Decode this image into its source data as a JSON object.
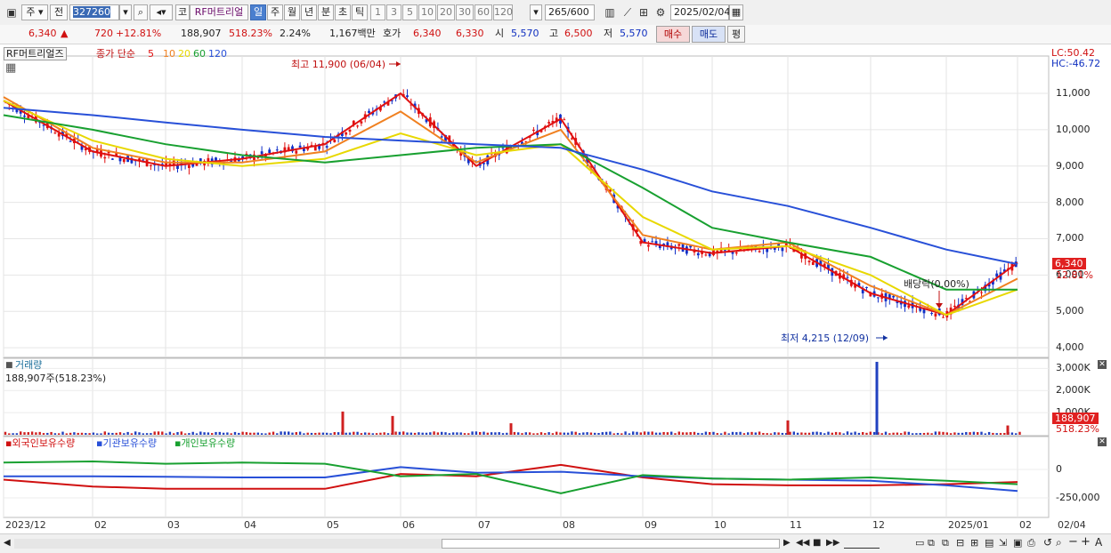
{
  "toolbar": {
    "market_label": "주",
    "jeon_label": "전",
    "code_value": "327260",
    "kospi_label": "코",
    "stock_name": "RF머트리얼",
    "periods": [
      "일",
      "주",
      "월",
      "년",
      "분",
      "초",
      "틱"
    ],
    "intervals": [
      "1",
      "3",
      "5",
      "10",
      "20",
      "30",
      "60",
      "120"
    ],
    "count_value": "265",
    "count_max": "/600",
    "date_value": "2025/02/04"
  },
  "quote": {
    "price": "6,340",
    "arrow": "▲",
    "change": "720",
    "change_pct": "+12.81%",
    "volume": "188,907",
    "volume_ratio": "518.23%",
    "turnover": "2.24%",
    "amount": "1,167백만",
    "hoga_label": "호가",
    "ask": "6,340",
    "bid": "6,330",
    "open_label": "시",
    "open": "5,570",
    "high_label": "고",
    "high": "6,500",
    "low_label": "저",
    "low": "5,570",
    "buy_label": "매수",
    "sell_label": "매도",
    "avg_label": "평"
  },
  "price_panel": {
    "title": "RF머트리얼즈",
    "ma_label": "종가 단순",
    "ma_periods": [
      "5",
      "10",
      "20",
      "60",
      "120"
    ],
    "ma_colors": [
      "#e01010",
      "#f08020",
      "#e8d800",
      "#18a030",
      "#2850d8"
    ],
    "high_note": "최고 11,900 (06/04)",
    "low_note": "최저 4,215 (12/09)",
    "dividend_note": "배당락(0.00%)",
    "lc": "LC:50.42",
    "hc": "HC:-46.72",
    "y_ticks": [
      "11,000",
      "10,000",
      "9,000",
      "8,000",
      "7,000",
      "6,000",
      "5,000",
      "4,000"
    ],
    "current_label": "6,340",
    "current_pct": "12.81%"
  },
  "volume_panel": {
    "title": "거래량",
    "info": "188,907주(518.23%)",
    "y_ticks": [
      "3,000K",
      "2,000K",
      "1,000K"
    ],
    "current_label": "188,907",
    "current_pct": "518.23%"
  },
  "holding_panel": {
    "legend": [
      "외국인보유수량",
      "기관보유수량",
      "개인보유수량"
    ],
    "legend_colors": [
      "#d01010",
      "#2850d8",
      "#18a030"
    ],
    "y_ticks": [
      "0",
      "-250,000"
    ]
  },
  "x_axis": {
    "labels": [
      "2023/12",
      "02",
      "03",
      "04",
      "05",
      "06",
      "07",
      "08",
      "09",
      "10",
      "11",
      "12",
      "2025/01",
      "02",
      "02/04"
    ]
  },
  "chart_data": [
    {
      "type": "line",
      "name": "price",
      "ylim": [
        4000,
        12000
      ],
      "x": [
        "2023/12",
        "02",
        "03",
        "04",
        "05",
        "06",
        "07",
        "08",
        "09",
        "10",
        "11",
        "12",
        "2025/01",
        "02"
      ],
      "series": [
        {
          "name": "5",
          "values": [
            10800,
            9400,
            9000,
            9200,
            9600,
            11000,
            9000,
            10300,
            6900,
            6600,
            6800,
            5500,
            4900,
            6340
          ]
        },
        {
          "name": "10",
          "values": [
            10900,
            9500,
            9100,
            9100,
            9400,
            10500,
            9100,
            10000,
            7100,
            6700,
            6900,
            5700,
            4900,
            5900
          ]
        },
        {
          "name": "20",
          "values": [
            10800,
            9700,
            9200,
            9000,
            9200,
            9900,
            9300,
            9600,
            7600,
            6700,
            6800,
            6000,
            4900,
            5600
          ]
        },
        {
          "name": "60",
          "values": [
            10400,
            10000,
            9600,
            9300,
            9100,
            9300,
            9500,
            9600,
            8400,
            7300,
            6900,
            6500,
            5600,
            5600
          ]
        },
        {
          "name": "120",
          "values": [
            10600,
            10400,
            10200,
            10000,
            9800,
            9700,
            9600,
            9500,
            8900,
            8300,
            7900,
            7300,
            6700,
            6300
          ]
        }
      ]
    },
    {
      "type": "bar",
      "name": "volume",
      "ylim": [
        0,
        3500000
      ],
      "spikes": [
        {
          "x": "05",
          "value": 1050000
        },
        {
          "x": "06",
          "value": 850000
        },
        {
          "x": "07",
          "value": 520000
        },
        {
          "x": "11",
          "value": 650000
        },
        {
          "x": "12",
          "value": 3300000
        },
        {
          "x": "02",
          "value": 420000
        }
      ]
    },
    {
      "type": "line",
      "name": "holdings",
      "ylim": [
        -400000,
        80000
      ],
      "series": [
        {
          "name": "외국인보유수량",
          "values": [
            -90000,
            -150000,
            -170000,
            -170000,
            -170000,
            -40000,
            -60000,
            40000,
            -70000,
            -130000,
            -140000,
            -140000,
            -130000,
            -110000
          ]
        },
        {
          "name": "기관보유수량",
          "values": [
            -60000,
            -60000,
            -65000,
            -70000,
            -70000,
            20000,
            -30000,
            -20000,
            -60000,
            -80000,
            -90000,
            -100000,
            -140000,
            -190000
          ]
        },
        {
          "name": "개인보유수량",
          "values": [
            60000,
            70000,
            50000,
            60000,
            50000,
            -60000,
            -40000,
            -210000,
            -50000,
            -80000,
            -90000,
            -70000,
            -100000,
            -130000
          ]
        }
      ]
    }
  ]
}
